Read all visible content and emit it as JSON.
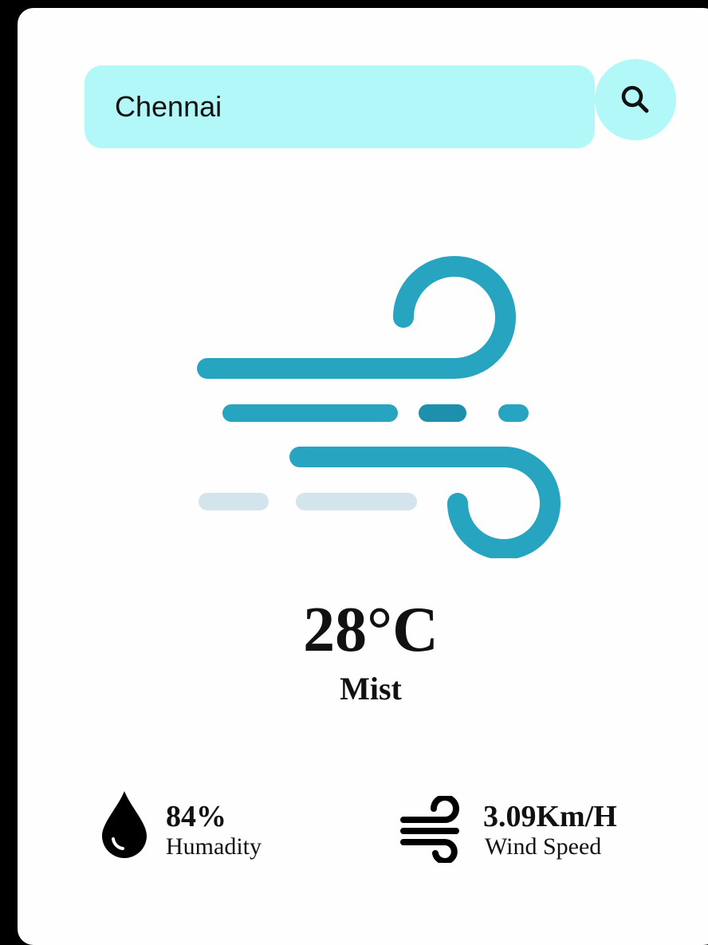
{
  "search": {
    "value": "Chennai",
    "icon": "search-icon"
  },
  "weather": {
    "icon": "wind-mist-icon",
    "temperature": "28°C",
    "condition": "Mist"
  },
  "humidity": {
    "icon": "water-drop-icon",
    "value": "84%",
    "label": "Humadity"
  },
  "wind": {
    "icon": "wind-icon",
    "value": "3.09Km/H",
    "label": "Wind Speed"
  },
  "colors": {
    "accent": "#b2f8f8",
    "icon_primary": "#27a4bf",
    "icon_light": "#d4e4ec"
  }
}
